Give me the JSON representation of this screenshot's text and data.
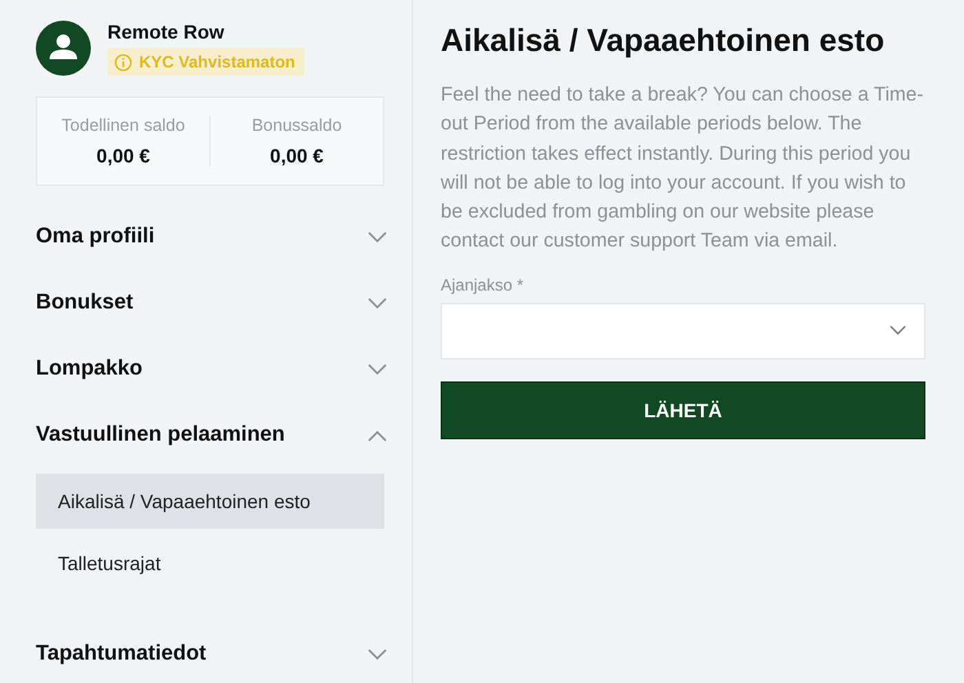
{
  "user": {
    "name": "Remote Row",
    "kyc_badge": "KYC Vahvistamaton"
  },
  "balances": [
    {
      "label": "Todellinen saldo",
      "value": "0,00 €"
    },
    {
      "label": "Bonussaldo",
      "value": "0,00 €"
    }
  ],
  "menu": [
    {
      "label": "Oma profiili",
      "expanded": false
    },
    {
      "label": "Bonukset",
      "expanded": false
    },
    {
      "label": "Lompakko",
      "expanded": false
    },
    {
      "label": "Vastuullinen pelaaminen",
      "expanded": true,
      "children": [
        {
          "label": "Aikalisä / Vapaaehtoinen esto",
          "selected": true
        },
        {
          "label": "Talletusrajat",
          "selected": false
        }
      ]
    },
    {
      "label": "Tapahtumatiedot",
      "expanded": false
    }
  ],
  "main": {
    "title": "Aikalisä / Vapaaehtoinen esto",
    "description": "Feel the need to take a break? You can choose a Time-out Period from the available periods below. The restriction takes effect instantly. During this period you will not be able to log into your account. If you wish to be excluded from gambling on our website please contact our customer support Team via email.",
    "field_label": "Ajanjakso *",
    "submit": "LÄHETÄ"
  }
}
